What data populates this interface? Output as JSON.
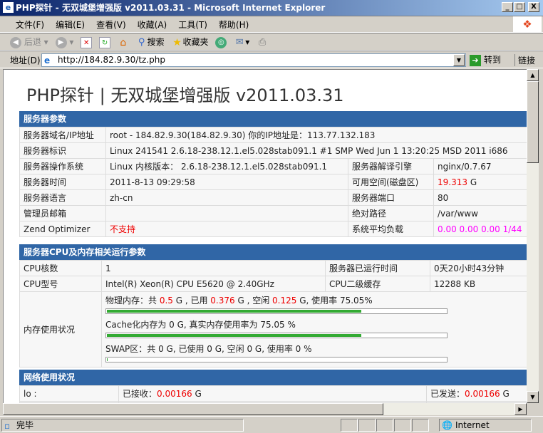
{
  "window": {
    "title": "PHP探针 - 无双城堡增强版 v2011.03.31 - Microsoft Internet Explorer",
    "min": "_",
    "max": "□",
    "close": "X"
  },
  "menu": [
    "文件(F)",
    "编辑(E)",
    "查看(V)",
    "收藏(A)",
    "工具(T)",
    "帮助(H)"
  ],
  "toolbar": {
    "back": "后退",
    "search": "搜索",
    "favorites": "收藏夹"
  },
  "address": {
    "label": "地址(D)",
    "url": "http://184.82.9.30/tz.php",
    "go": "转到",
    "links": "链接"
  },
  "page": {
    "title": "PHP探针 | 无双城堡增强版 v2011.03.31"
  },
  "server": {
    "header": "服务器参数",
    "domain_label": "服务器域名/IP地址",
    "domain_value": "root - 184.82.9.30(184.82.9.30)  你的IP地址是：113.77.132.183",
    "ident_label": "服务器标识",
    "ident_value": "Linux 241541 2.6.18-238.12.1.el5.028stab091.1 #1 SMP Wed Jun 1 13:20:25 MSD 2011 i686",
    "os_label": "服务器操作系统",
    "os_value": "Linux  内核版本： 2.6.18-238.12.1.el5.028stab091.1",
    "engine_label": "服务器解译引擎",
    "engine_value": "nginx/0.7.67",
    "time_label": "服务器时间",
    "time_value": "2011-8-13 09:29:58",
    "disk_label": "可用空间(磁盘区)",
    "disk_value": "19.313",
    "disk_unit": " G",
    "lang_label": "服务器语言",
    "lang_value": "zh-cn",
    "port_label": "服务器端口",
    "port_value": "80",
    "admin_label": "管理员邮箱",
    "admin_value": "",
    "path_label": "绝对路径",
    "path_value": "/var/www",
    "zend_label": "Zend Optimizer",
    "zend_value": "不支持",
    "load_label": "系统平均负载",
    "load_value": "0.00 0.00 0.00 1/44"
  },
  "cpu": {
    "header": "服务器CPU及内存相关运行参数",
    "cores_label": "CPU核数",
    "cores_value": "1",
    "uptime_label": "服务器已运行时间",
    "uptime_value": "0天20小时43分钟",
    "model_label": "CPU型号",
    "model_value": "Intel(R) Xeon(R) CPU E5620 @ 2.40GHz",
    "cache_label": "CPU二级缓存",
    "cache_value": "12288 KB",
    "mem_label": "内存使用状况",
    "phys": {
      "p1": "物理内存：共 ",
      "total": "0.5",
      "p2": " G , 已用 ",
      "used": "0.376",
      "p3": " G , 空闲 ",
      "free": "0.125",
      "p4": " G, 使用率 75.05%",
      "percent": 75.05
    },
    "cached": {
      "text": "Cache化内存为 0 G, 真实内存使用率为 75.05 %",
      "percent": 75.05
    },
    "swap": {
      "text": "SWAP区：共 0 G, 已使用 0 G, 空闲 0 G, 使用率 0 %",
      "percent": 0
    }
  },
  "network": {
    "header": "网络使用状况",
    "iface": "lo :",
    "rx_label": "已接收：",
    "rx": "0.00166",
    "tx_label": "已发送：",
    "tx": "0.00166",
    "unit": " G"
  },
  "status": {
    "text": "完毕",
    "zone": "Internet"
  }
}
